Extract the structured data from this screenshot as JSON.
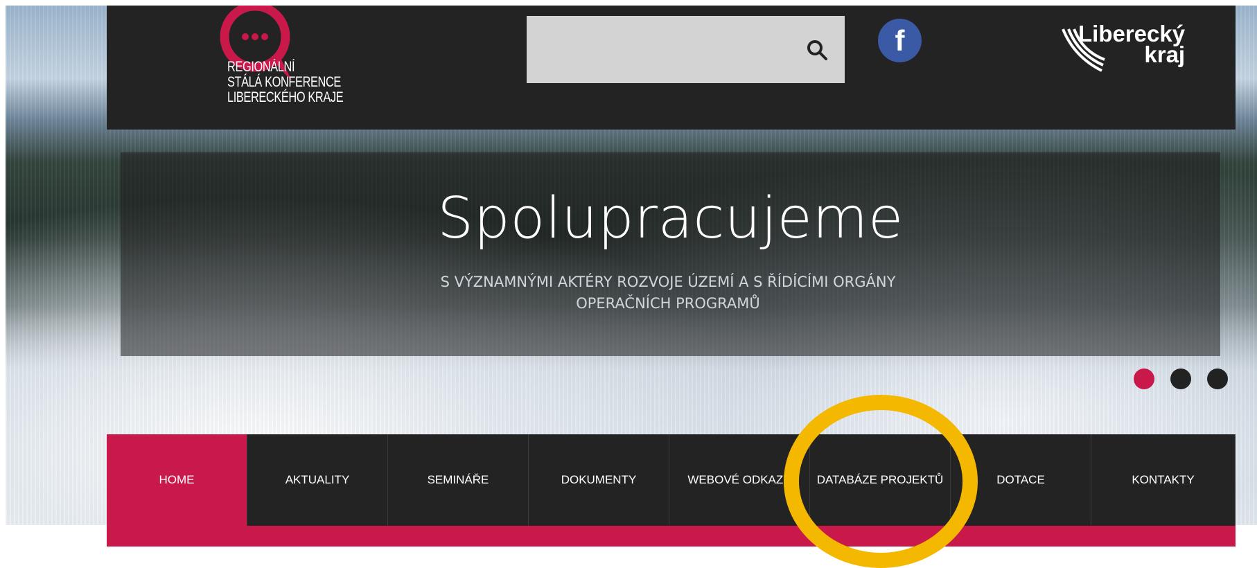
{
  "header": {
    "logo_lines": [
      "REGIONÁLNÍ",
      "STÁLÁ KONFERENCE",
      "LIBERECKÉHO KRAJE"
    ],
    "search": {
      "value": "",
      "placeholder": ""
    },
    "facebook_glyph": "f",
    "region_logo_lines": [
      "Liberecký",
      "kraj"
    ]
  },
  "slider": {
    "title": "Spolupracujeme",
    "subtitle": "S VÝZNAMNÝMI AKTÉRY ROZVOJE ÚZEMÍ A S ŘÍDÍCÍMI ORGÁNY OPERAČNÍCH PROGRAMŮ",
    "dots": [
      {
        "active": true,
        "color": "#c8194a"
      },
      {
        "active": false,
        "color": "#222222"
      },
      {
        "active": false,
        "color": "#222222"
      }
    ]
  },
  "nav": {
    "items": [
      {
        "label": "HOME",
        "active": true
      },
      {
        "label": "AKTUALITY",
        "active": false
      },
      {
        "label": "SEMINÁŘE",
        "active": false
      },
      {
        "label": "DOKUMENTY",
        "active": false
      },
      {
        "label": "WEBOVÉ ODKAZY",
        "active": false
      },
      {
        "label": "DATABÁZE PROJEKTŮ",
        "active": false
      },
      {
        "label": "DOTACE",
        "active": false
      },
      {
        "label": "KONTAKTY",
        "active": false
      }
    ]
  },
  "colors": {
    "brand": "#c8194a",
    "header_bg": "#232323",
    "highlight": "#f5b800"
  }
}
